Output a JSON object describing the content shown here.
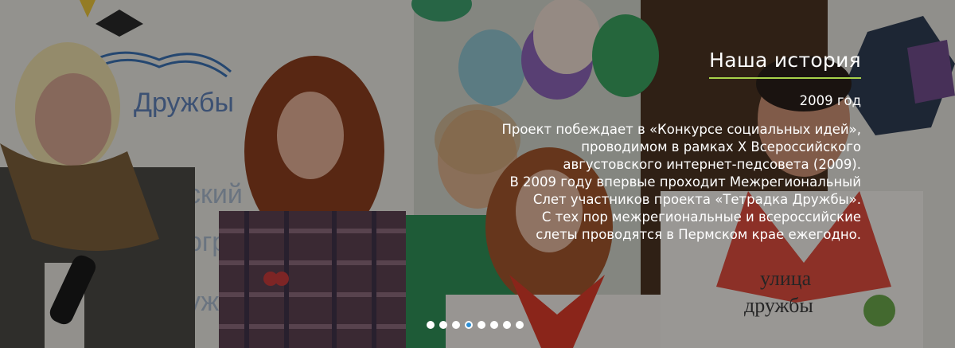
{
  "slide": {
    "title": "Наша история",
    "year": "2009 год",
    "lines": [
      "Проект побеждает в «Конкурсе социальных идей»,",
      "проводимом в рамках X Всероссийского",
      "августовского интернет-педсовета (2009).",
      "В 2009 году впервые проходит Межрегиональный",
      "Слет участников проекта «Тетрадка Дружбы».",
      "С тех пор межрегиональные и всероссийские",
      "слеты проводятся в Пермском крае ежегодно."
    ]
  },
  "banner_text": "Дружбы",
  "pagination": {
    "total": 8,
    "active": 4
  },
  "colors": {
    "accent": "#a8d24a",
    "active_dot": "#2d8fd5"
  }
}
